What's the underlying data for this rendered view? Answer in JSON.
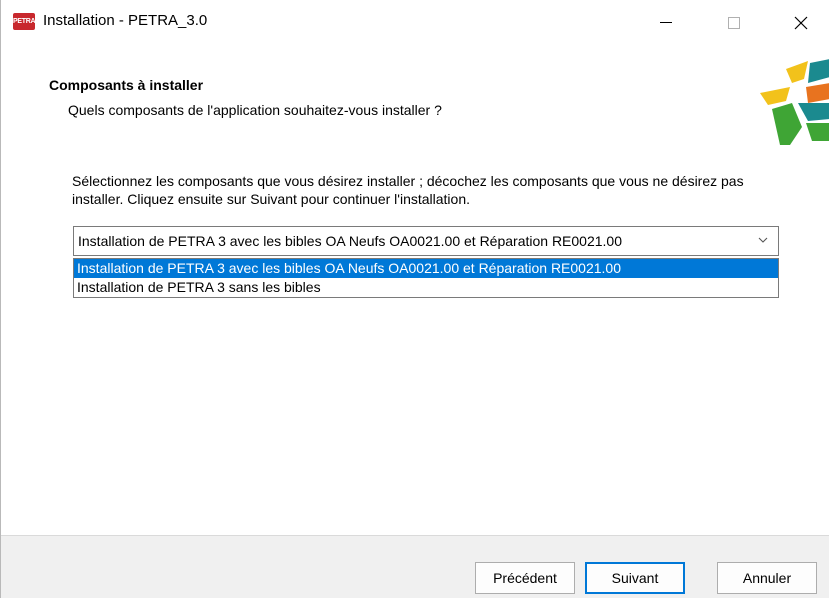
{
  "window": {
    "icon_text": "PETRA",
    "title": "Installation - PETRA_3.0",
    "controls": {
      "minimize": "minimize-icon",
      "maximize": "maximize-icon",
      "close": "close-icon"
    }
  },
  "header": {
    "title": "Composants à installer",
    "subtitle": "Quels composants de l'application souhaitez-vous installer ?"
  },
  "content": {
    "instructions": "Sélectionnez les composants que vous désirez installer ; décochez les composants que vous ne désirez pas installer. Cliquez ensuite sur Suivant pour continuer l'installation.",
    "combo": {
      "value": "Installation de PETRA 3 avec les bibles OA Neufs OA0021.00 et Réparation RE0021.00",
      "options": [
        {
          "label": "Installation de PETRA 3 avec les bibles OA Neufs OA0021.00 et Réparation RE0021.00",
          "selected": true
        },
        {
          "label": "Installation de PETRA 3 sans les bibles",
          "selected": false
        }
      ]
    }
  },
  "footer": {
    "prev_label": "Précédent",
    "next_label": "Suivant",
    "cancel_label": "Annuler"
  },
  "colors": {
    "accent": "#0078d7",
    "logo_yellow": "#f2c21b",
    "logo_green": "#3fa535",
    "logo_teal": "#1b8a8f",
    "logo_orange": "#e8731f",
    "icon_red": "#c8282d"
  }
}
